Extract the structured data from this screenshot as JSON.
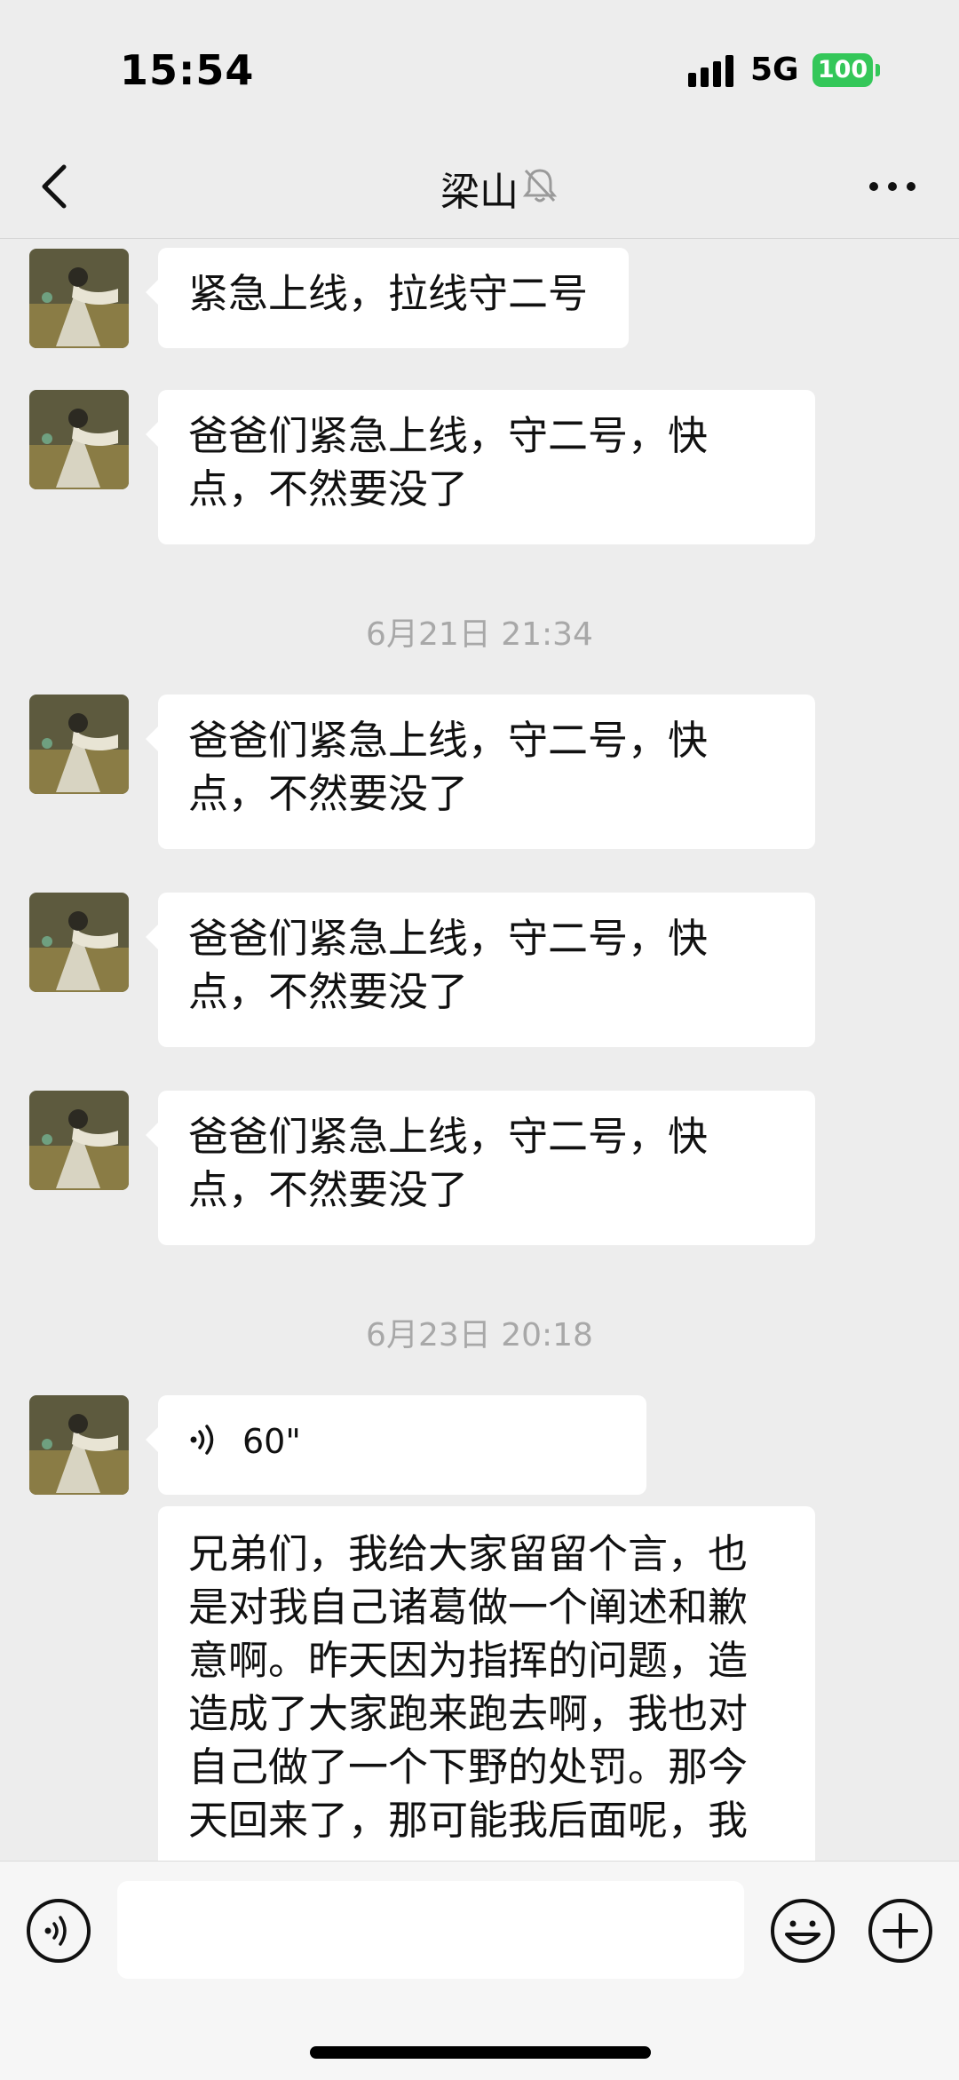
{
  "status_bar": {
    "time": "15:54",
    "network": "5G",
    "battery": "100"
  },
  "header": {
    "title": "梁山",
    "muted": true
  },
  "messages": [
    {
      "type": "text",
      "text": "紧急上线，拉线守二号"
    },
    {
      "type": "text",
      "text": "爸爸们紧急上线，守二号，快点，不然要没了"
    },
    {
      "type": "timestamp",
      "text": "6月21日 21:34"
    },
    {
      "type": "text",
      "text": "爸爸们紧急上线，守二号，快点，不然要没了"
    },
    {
      "type": "text",
      "text": "爸爸们紧急上线，守二号，快点，不然要没了"
    },
    {
      "type": "text",
      "text": "爸爸们紧急上线，守二号，快点，不然要没了"
    },
    {
      "type": "timestamp",
      "text": "6月23日 20:18"
    },
    {
      "type": "voice",
      "duration": "60\""
    },
    {
      "type": "transcript",
      "text": "兄弟们，我给大家留留个言，也是对我自己诸葛做一个阐述和歉意啊。昨天因为指挥的问题，造造成了大家跑来跑去啊，我也对自己做了一个下野的处罚。那今天回来了，那可能我后面呢，我"
    }
  ],
  "input": {
    "placeholder": ""
  },
  "colors": {
    "background": "#ededed",
    "bubble": "#ffffff",
    "battery": "#34c759",
    "timestamp": "#a8a8a8"
  },
  "icons": [
    "back-icon",
    "mute-bell-icon",
    "more-icon",
    "voice-wave-icon",
    "voice-mode-icon",
    "emoji-icon",
    "plus-icon",
    "avatar"
  ]
}
